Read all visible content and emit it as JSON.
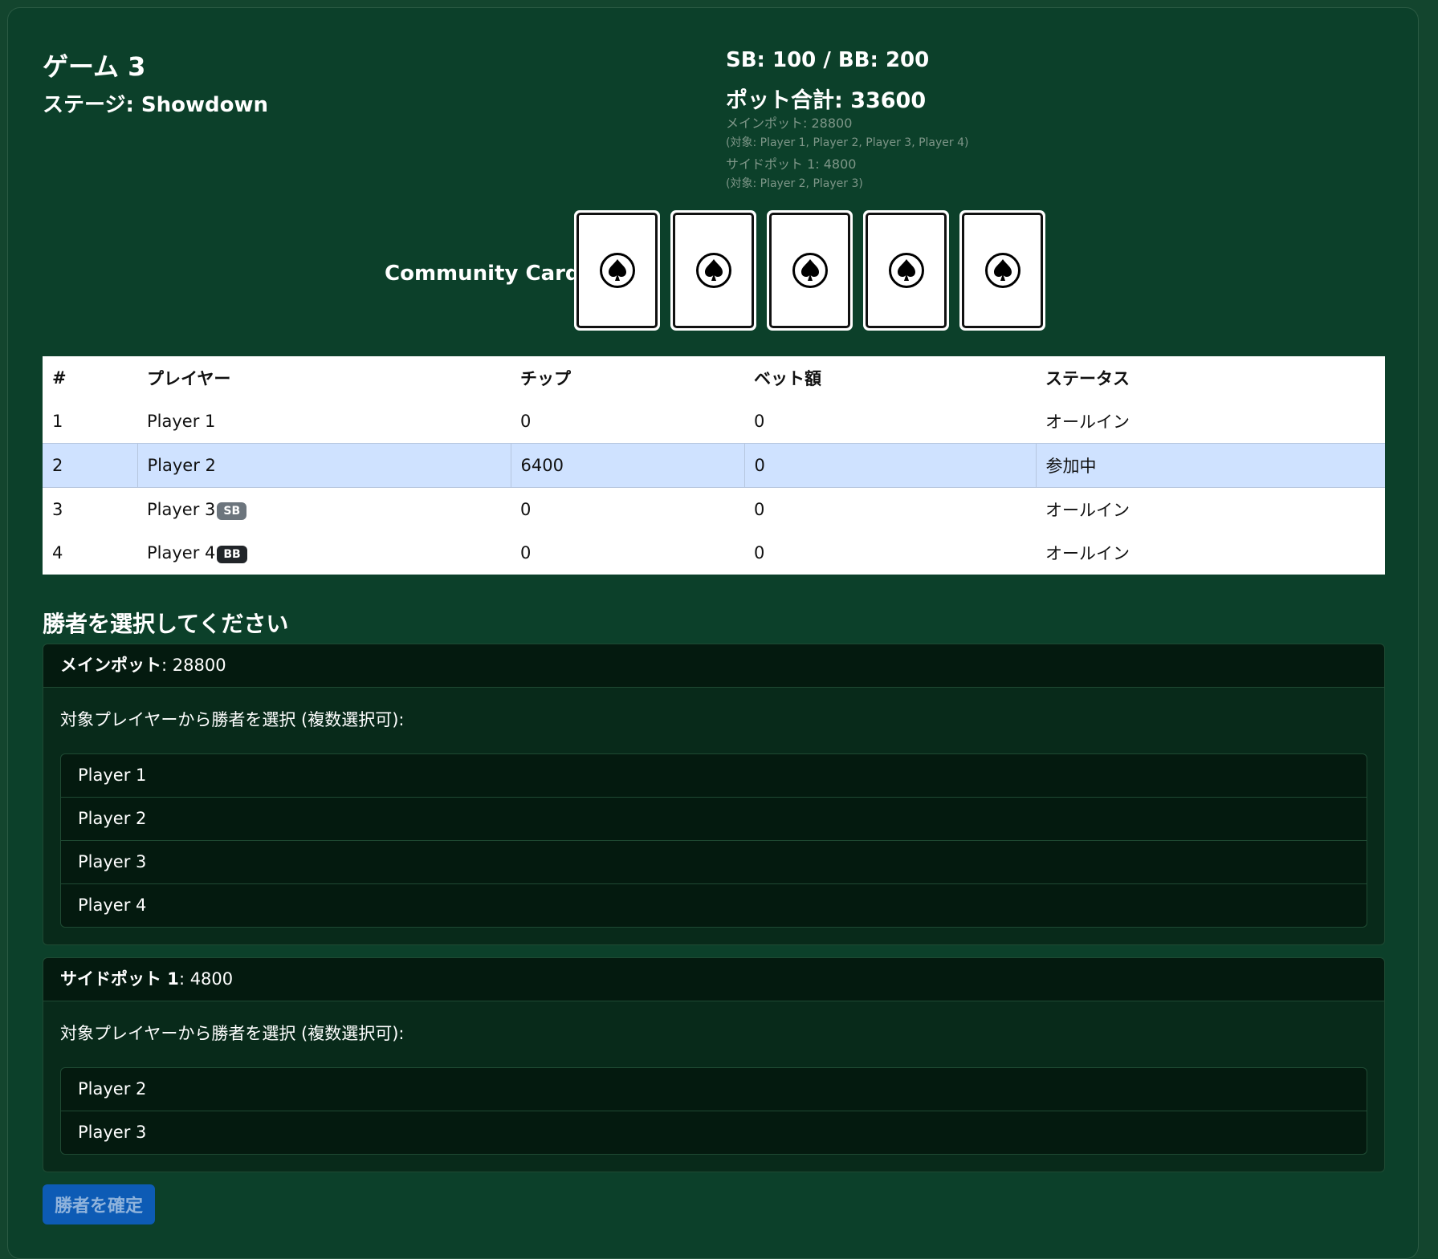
{
  "game": {
    "title": "ゲーム 3",
    "stage": "ステージ: Showdown"
  },
  "pot": {
    "blinds": "SB: 100 / BB: 200",
    "total": "ポット合計: 33600",
    "details": [
      "メインポット: 28800",
      "(対象: Player 1, Player 2, Player 3, Player 4)",
      "サイドポット 1: 4800",
      "(対象: Player 2, Player 3)"
    ]
  },
  "community": {
    "label": "Community Cards:",
    "cards": [
      "spade-icon",
      "spade-icon",
      "spade-icon",
      "spade-icon",
      "spade-icon"
    ]
  },
  "table": {
    "headers": [
      "#",
      "プレイヤー",
      "チップ",
      "ベット額",
      "ステータス"
    ],
    "rows": [
      {
        "num": "1",
        "name": "Player 1",
        "badge": "",
        "chips": "0",
        "bet": "0",
        "status": "オールイン"
      },
      {
        "num": "2",
        "name": "Player 2",
        "badge": "",
        "chips": "6400",
        "bet": "0",
        "status": "参加中"
      },
      {
        "num": "3",
        "name": "Player 3",
        "badge": "SB",
        "chips": "0",
        "bet": "0",
        "status": "オールイン"
      },
      {
        "num": "4",
        "name": "Player 4",
        "badge": "BB",
        "chips": "0",
        "bet": "0",
        "status": "オールイン"
      }
    ]
  },
  "winner": {
    "heading": "勝者を選択してください",
    "pots": [
      {
        "name": "メインポット",
        "amount": ": 28800",
        "instruction": "対象プレイヤーから勝者を選択 (複数選択可):",
        "players": [
          "Player 1",
          "Player 2",
          "Player 3",
          "Player 4"
        ]
      },
      {
        "name": "サイドポット 1",
        "amount": ": 4800",
        "instruction": "対象プレイヤーから勝者を選択 (複数選択可):",
        "players": [
          "Player 2",
          "Player 3"
        ]
      }
    ],
    "confirm_label": "勝者を確定"
  },
  "colors": {
    "background": "#0c402a",
    "highlight_row": "#cfe2ff",
    "confirm_button": "#0d5bb5"
  }
}
